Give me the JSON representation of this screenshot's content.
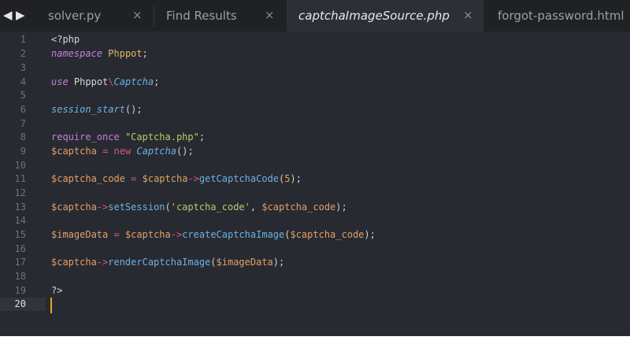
{
  "nav": {
    "back_icon": "◀",
    "forward_icon": "▶"
  },
  "tabs": [
    {
      "label": "solver.py",
      "close": "×",
      "active": false
    },
    {
      "label": "Find Results",
      "close": "×",
      "active": false
    },
    {
      "label": "captchaImageSource.php",
      "close": "×",
      "active": true
    },
    {
      "label": "forgot-password.html",
      "close": "",
      "active": false
    }
  ],
  "line_numbers": [
    "1",
    "2",
    "3",
    "4",
    "5",
    "6",
    "7",
    "8",
    "9",
    "10",
    "11",
    "12",
    "13",
    "14",
    "15",
    "16",
    "17",
    "18",
    "19",
    "20"
  ],
  "code": {
    "l1_open": "<?php",
    "l2_kw": "namespace",
    "l2_ns": "Phppot",
    "l2_semi": ";",
    "l4_kw": "use",
    "l4_a": "Phppot",
    "l4_sep": "\\",
    "l4_b": "Captcha",
    "l4_semi": ";",
    "l6_fn": "session_start",
    "l6_rest": "();",
    "l8_kw": "require_once",
    "l8_str": "\"Captcha.php\"",
    "l8_semi": ";",
    "l9_var": "$captcha",
    "l9_eq": "=",
    "l9_new": "new",
    "l9_class": "Captcha",
    "l9_rest": "();",
    "l11_var": "$captcha_code",
    "l11_eq": "=",
    "l11_obj": "$captcha",
    "l11_arrow": "->",
    "l11_method": "getCaptchaCode",
    "l11_p1": "(",
    "l11_num": "5",
    "l11_p2": ");",
    "l13_obj": "$captcha",
    "l13_arrow": "->",
    "l13_method": "setSession",
    "l13_p1": "(",
    "l13_str": "'captcha_code'",
    "l13_comma": ", ",
    "l13_var": "$captcha_code",
    "l13_p2": ");",
    "l15_var": "$imageData",
    "l15_eq": "=",
    "l15_obj": "$captcha",
    "l15_arrow": "->",
    "l15_method": "createCaptchaImage",
    "l15_p1": "(",
    "l15_arg": "$captcha_code",
    "l15_p2": ");",
    "l17_obj": "$captcha",
    "l17_arrow": "->",
    "l17_method": "renderCaptchaImage",
    "l17_p1": "(",
    "l17_arg": "$imageData",
    "l17_p2": ");",
    "l19_close": "?>"
  },
  "colors": {
    "background": "#272a30",
    "tabbar": "#1f2125",
    "caret": "#f0a020"
  }
}
